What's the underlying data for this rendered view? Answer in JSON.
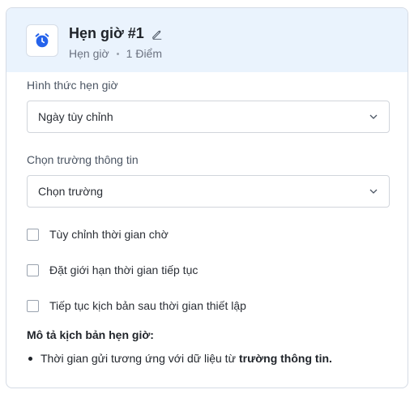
{
  "header": {
    "title": "Hẹn giờ #1",
    "type": "Hẹn giờ",
    "points": "1 Điểm",
    "icon": "alarm-clock-icon",
    "accent_color": "#2563eb"
  },
  "form": {
    "timer_type": {
      "label": "Hình thức hẹn giờ",
      "value": "Ngày tùy chỉnh"
    },
    "field_select": {
      "label": "Chọn trường thông tin",
      "value": "Chọn trường"
    },
    "options": [
      {
        "label": "Tùy chỉnh thời gian chờ",
        "checked": false
      },
      {
        "label": "Đặt giới hạn thời gian tiếp tục",
        "checked": false
      },
      {
        "label": "Tiếp tục kịch bản sau thời gian thiết lập",
        "checked": false
      }
    ]
  },
  "description": {
    "title": "Mô tả kịch bản hẹn giờ:",
    "item_text": "Thời gian gửi tương ứng với dữ liệu từ",
    "item_bold": "trường thông tin."
  }
}
